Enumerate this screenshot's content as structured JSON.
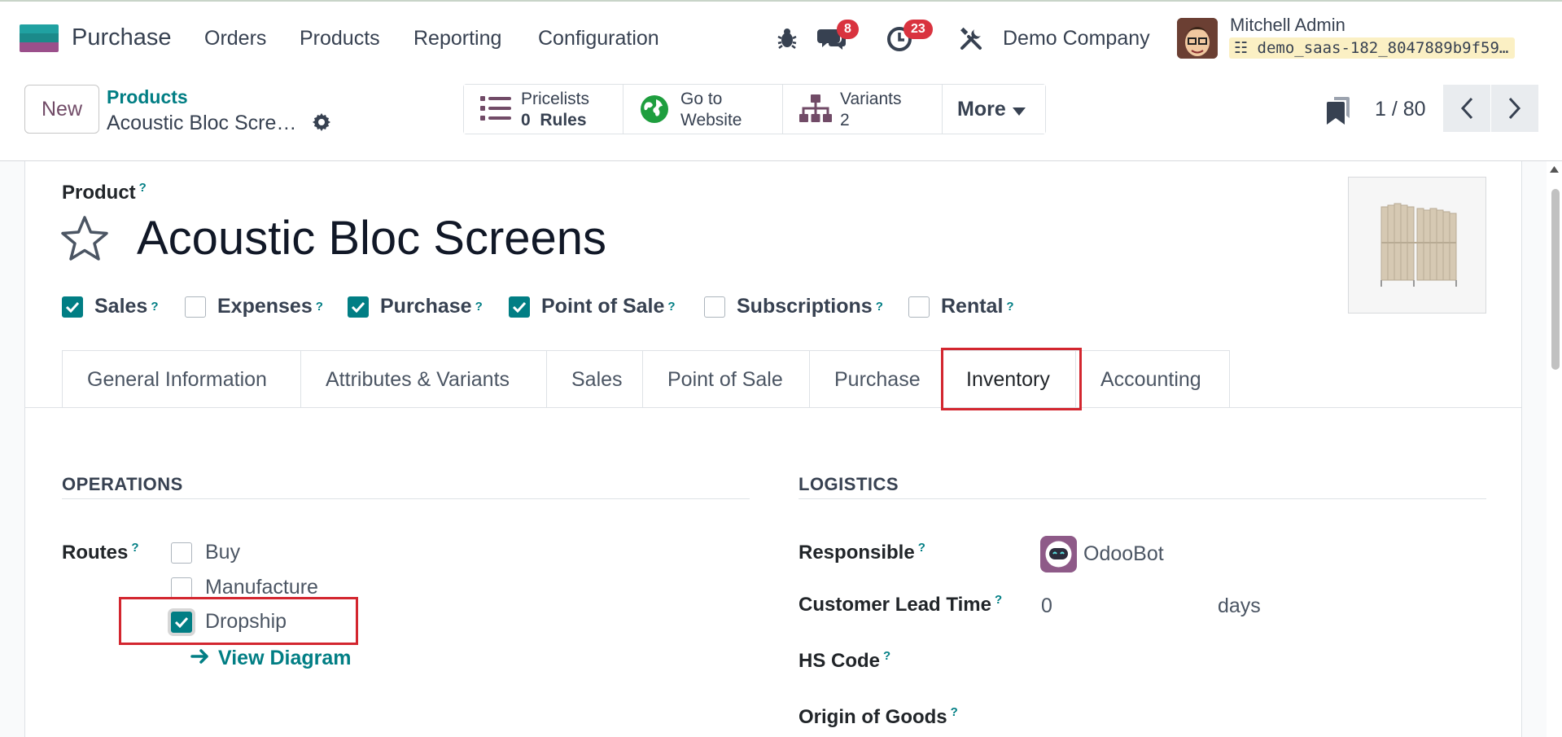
{
  "navbar": {
    "app_name": "Purchase",
    "menus": [
      "Orders",
      "Products",
      "Reporting",
      "Configuration"
    ],
    "messages_badge": "8",
    "activities_badge": "23",
    "company": "Demo Company",
    "user_name": "Mitchell Admin",
    "database": "demo_saas-182_8047889b9f59…"
  },
  "control_panel": {
    "new_label": "New",
    "breadcrumb_parent": "Products",
    "breadcrumb_current": "Acoustic Bloc Scre…",
    "smart_buttons": [
      {
        "line1": "Pricelists",
        "line2_count": "0",
        "line2_label": "Rules",
        "icon": "list-icon"
      },
      {
        "line1": "Go to",
        "line2_label": "Website",
        "icon": "globe-icon"
      },
      {
        "line1": "Variants",
        "line2_count": "2",
        "icon": "sitemap-icon"
      }
    ],
    "more_label": "More",
    "pager": "1 / 80"
  },
  "product": {
    "label": "Product",
    "help": "?",
    "name": "Acoustic Bloc Screens",
    "flags": [
      {
        "label": "Sales",
        "checked": true
      },
      {
        "label": "Expenses",
        "checked": false
      },
      {
        "label": "Purchase",
        "checked": true
      },
      {
        "label": "Point of Sale",
        "checked": true
      },
      {
        "label": "Subscriptions",
        "checked": false
      },
      {
        "label": "Rental",
        "checked": false
      }
    ]
  },
  "tabs": [
    "General Information",
    "Attributes & Variants",
    "Sales",
    "Point of Sale",
    "Purchase",
    "Inventory",
    "Accounting"
  ],
  "active_tab": "Inventory",
  "operations": {
    "title": "OPERATIONS",
    "routes_label": "Routes",
    "routes": [
      {
        "label": "Buy",
        "checked": false
      },
      {
        "label": "Manufacture",
        "checked": false
      },
      {
        "label": "Dropship",
        "checked": true
      }
    ],
    "view_diagram": "View Diagram"
  },
  "logistics": {
    "title": "LOGISTICS",
    "responsible_label": "Responsible",
    "responsible_value": "OdooBot",
    "lead_time_label": "Customer Lead Time",
    "lead_time_value": "0",
    "lead_time_unit": "days",
    "hs_code_label": "HS Code",
    "origin_label": "Origin of Goods"
  },
  "colors": {
    "accent": "#017e84",
    "brand": "#714b67",
    "highlight": "#d3262f",
    "badge": "#d9333f"
  }
}
